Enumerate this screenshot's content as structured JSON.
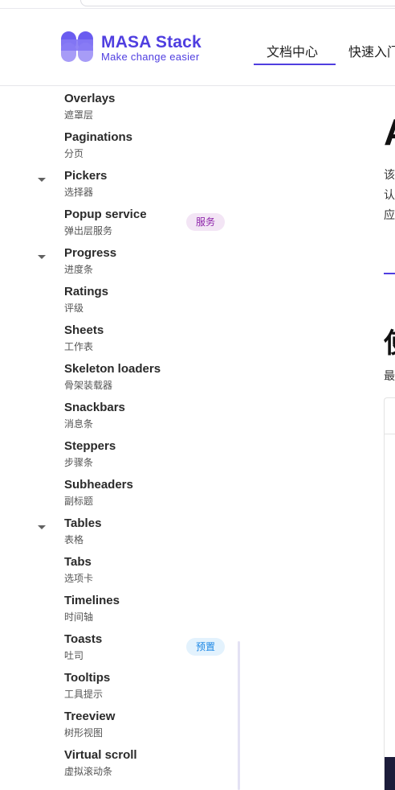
{
  "header": {
    "brand_name": "MASA Stack",
    "brand_tagline": "Make change easier",
    "nav_tabs": [
      {
        "label": "文档中心",
        "active": true
      },
      {
        "label": "快速入门",
        "active": false
      }
    ],
    "accent_color": "#4f3ee0"
  },
  "sidebar": {
    "items": [
      {
        "title": "Overlays",
        "subtitle": "遮罩层",
        "expandable": false,
        "badge": null
      },
      {
        "title": "Paginations",
        "subtitle": "分页",
        "expandable": false,
        "badge": null
      },
      {
        "title": "Pickers",
        "subtitle": "选择器",
        "expandable": true,
        "badge": null
      },
      {
        "title": "Popup service",
        "subtitle": "弹出层服务",
        "expandable": false,
        "badge": "服务"
      },
      {
        "title": "Progress",
        "subtitle": "进度条",
        "expandable": true,
        "badge": null
      },
      {
        "title": "Ratings",
        "subtitle": "评级",
        "expandable": false,
        "badge": null
      },
      {
        "title": "Sheets",
        "subtitle": "工作表",
        "expandable": false,
        "badge": null
      },
      {
        "title": "Skeleton loaders",
        "subtitle": "骨架装载器",
        "expandable": false,
        "badge": null
      },
      {
        "title": "Snackbars",
        "subtitle": "消息条",
        "expandable": false,
        "badge": null
      },
      {
        "title": "Steppers",
        "subtitle": "步骤条",
        "expandable": false,
        "badge": null
      },
      {
        "title": "Subheaders",
        "subtitle": "副标题",
        "expandable": false,
        "badge": null
      },
      {
        "title": "Tables",
        "subtitle": "表格",
        "expandable": true,
        "badge": null
      },
      {
        "title": "Tabs",
        "subtitle": "选项卡",
        "expandable": false,
        "badge": null
      },
      {
        "title": "Timelines",
        "subtitle": "时间轴",
        "expandable": false,
        "badge": null
      },
      {
        "title": "Toasts",
        "subtitle": "吐司",
        "expandable": false,
        "badge": "预置"
      },
      {
        "title": "Tooltips",
        "subtitle": "工具提示",
        "expandable": false,
        "badge": null
      },
      {
        "title": "Treeview",
        "subtitle": "树形视图",
        "expandable": false,
        "badge": null
      },
      {
        "title": "Virtual scroll",
        "subtitle": "虚拟滚动条",
        "expandable": false,
        "badge": null
      }
    ],
    "badge_colors": {
      "服务": {
        "bg": "#f3e5f5",
        "fg": "#8e24aa"
      },
      "预置": {
        "bg": "#e3f2fd",
        "fg": "#1e88e5"
      }
    }
  },
  "main": {
    "title_fragment": "A",
    "intro_fragments": [
      "该",
      "认",
      "应"
    ],
    "section_heading_fragment": "使",
    "section_text_fragment": "最"
  }
}
